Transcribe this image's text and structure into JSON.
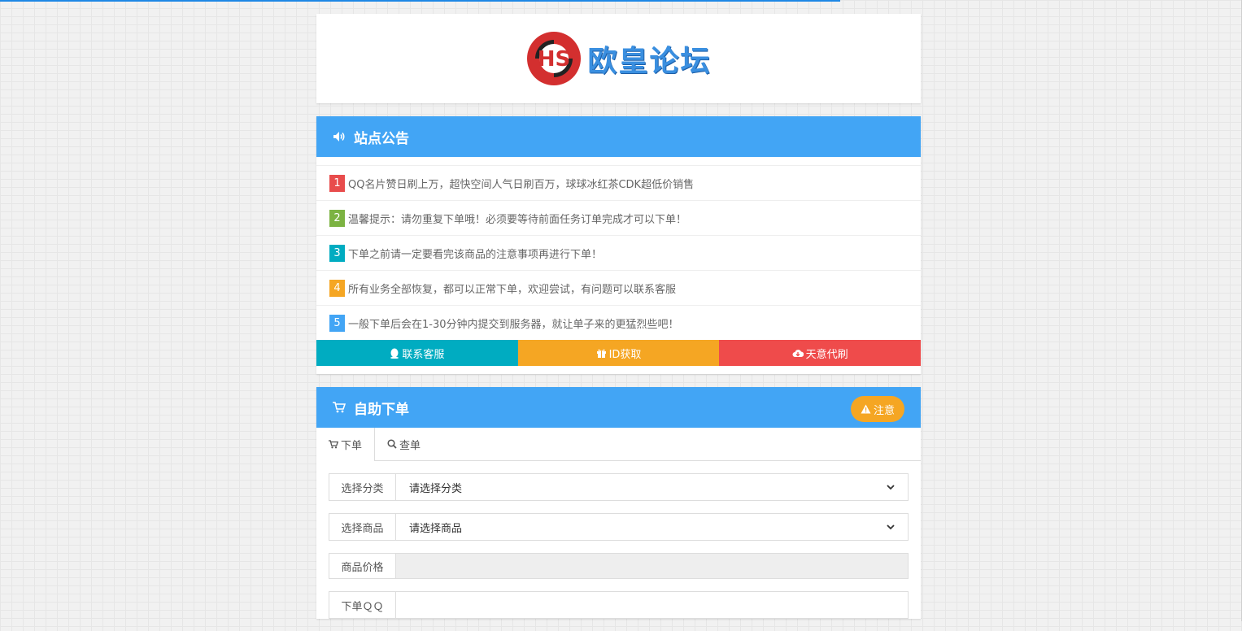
{
  "logo": {
    "text": "欧皇论坛",
    "mark_letters": "HS"
  },
  "announcement": {
    "title": "站点公告",
    "items": [
      {
        "num": "1",
        "color": "#e84c4c",
        "text": "QQ名片赞日刷上万，超快空间人气日刷百万，球球冰红茶CDK超低价销售"
      },
      {
        "num": "2",
        "color": "#7cb342",
        "text": "温馨提示：请勿重复下单哦！必须要等待前面任务订单完成才可以下单！"
      },
      {
        "num": "3",
        "color": "#00acc1",
        "text": "下单之前请一定要看完该商品的注意事项再进行下单！"
      },
      {
        "num": "4",
        "color": "#f5a623",
        "text": "所有业务全部恢复，都可以正常下单，欢迎尝试，有问题可以联系客服"
      },
      {
        "num": "5",
        "color": "#42a5f5",
        "text": "一般下单后会在1-30分钟内提交到服务器，就让单子来的更猛烈些吧！"
      }
    ],
    "buttons": [
      {
        "label": "联系客服",
        "icon": "qq-icon",
        "color": "#00acc1"
      },
      {
        "label": "ID获取",
        "icon": "gift-icon",
        "color": "#f5a623"
      },
      {
        "label": "天意代刷",
        "icon": "cloud-download-icon",
        "color": "#ef4b4b"
      }
    ]
  },
  "order": {
    "title": "自助下单",
    "attention_label": "注意",
    "tabs": [
      {
        "label": "下单",
        "icon": "cart-icon",
        "active": true
      },
      {
        "label": "查单",
        "icon": "search-icon",
        "active": false
      }
    ],
    "fields": {
      "category": {
        "label": "选择分类",
        "value": "请选择分类"
      },
      "product": {
        "label": "选择商品",
        "value": "请选择商品"
      },
      "price": {
        "label": "商品价格",
        "value": ""
      },
      "qq": {
        "label": "下单ＱＱ",
        "value": ""
      }
    }
  },
  "colors": {
    "accent": "#42a5f5",
    "top_progress": "#1e88e5"
  }
}
